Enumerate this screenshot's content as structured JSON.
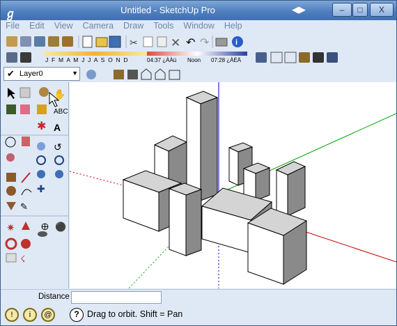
{
  "window": {
    "title": "Untitled - SketchUp Pro",
    "minimize": "–",
    "maximize": "□",
    "close": "X"
  },
  "menu": [
    "File",
    "Edit",
    "View",
    "Camera",
    "Draw",
    "Tools",
    "Window",
    "Help"
  ],
  "shadow_bar": {
    "months": "J F M A M J J A S O N D",
    "time_start": "04:37 ¿ÀÀü",
    "time_noon": "Noon",
    "time_end": "07:28 ¿ÀÈÄ"
  },
  "layer": {
    "name": "Layer0"
  },
  "status": {
    "distance_label": "Distance",
    "distance_value": "",
    "hint": "Drag to orbit.  Shift = Pan"
  },
  "colors": {
    "accent": "#4f7fbf",
    "axis_red": "#c00000",
    "axis_green": "#00a000",
    "axis_blue": "#0000c0"
  }
}
